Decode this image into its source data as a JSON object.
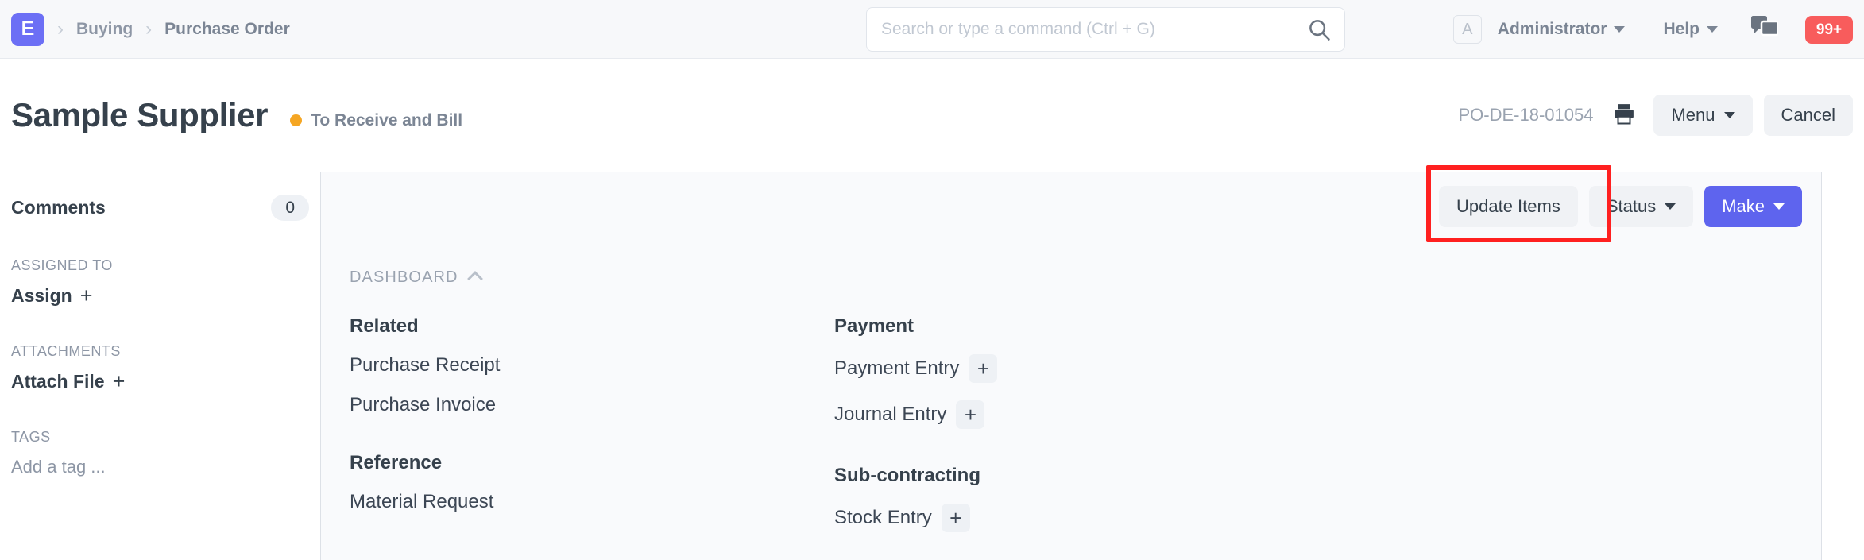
{
  "navbar": {
    "logo_text": "E",
    "logo_color": "#6c6ff5",
    "breadcrumbs": [
      {
        "label": "Buying"
      },
      {
        "label": "Purchase Order"
      }
    ],
    "search": {
      "value": "",
      "placeholder": "Search or type a command (Ctrl + G)",
      "icon": "search-icon"
    },
    "avatar_initial": "A",
    "user_label": "Administrator",
    "help_label": "Help",
    "chat_icon": "chat-bubbles-icon",
    "notification_badge": "99+",
    "notification_color": "#f85c5c"
  },
  "titlebar": {
    "title": "Sample Supplier",
    "status_text": "To Receive and Bill",
    "status_color": "#f5a623",
    "document_id": "PO-DE-18-01054",
    "print_icon": "printer-icon",
    "menu_label": "Menu",
    "cancel_label": "Cancel"
  },
  "sidebar": {
    "comments_label": "Comments",
    "comments_count": "0",
    "assigned_to_label": "ASSIGNED TO",
    "assign_label": "Assign",
    "attachments_label": "ATTACHMENTS",
    "attach_file_label": "Attach File",
    "tags_label": "TAGS",
    "add_tag_label": "Add a tag ...",
    "plus_glyph": "+"
  },
  "toolbar": {
    "update_items_label": "Update Items",
    "status_label": "Status",
    "make_label": "Make",
    "make_color": "#5e64ee"
  },
  "dashboard": {
    "section_label": "DASHBOARD",
    "collapse_icon": "chevron-up-icon",
    "columns": [
      {
        "groups": [
          {
            "heading": "Related",
            "items": [
              {
                "label": "Purchase Receipt",
                "has_plus": false
              },
              {
                "label": "Purchase Invoice",
                "has_plus": false
              }
            ]
          },
          {
            "heading": "Reference",
            "items": [
              {
                "label": "Material Request",
                "has_plus": false
              }
            ]
          }
        ]
      },
      {
        "groups": [
          {
            "heading": "Payment",
            "items": [
              {
                "label": "Payment Entry",
                "has_plus": true
              },
              {
                "label": "Journal Entry",
                "has_plus": true
              }
            ]
          },
          {
            "heading": "Sub-contracting",
            "items": [
              {
                "label": "Stock Entry",
                "has_plus": true
              }
            ]
          }
        ]
      }
    ]
  },
  "highlight": {
    "target": "update-items-button",
    "color": "#ff2020"
  }
}
